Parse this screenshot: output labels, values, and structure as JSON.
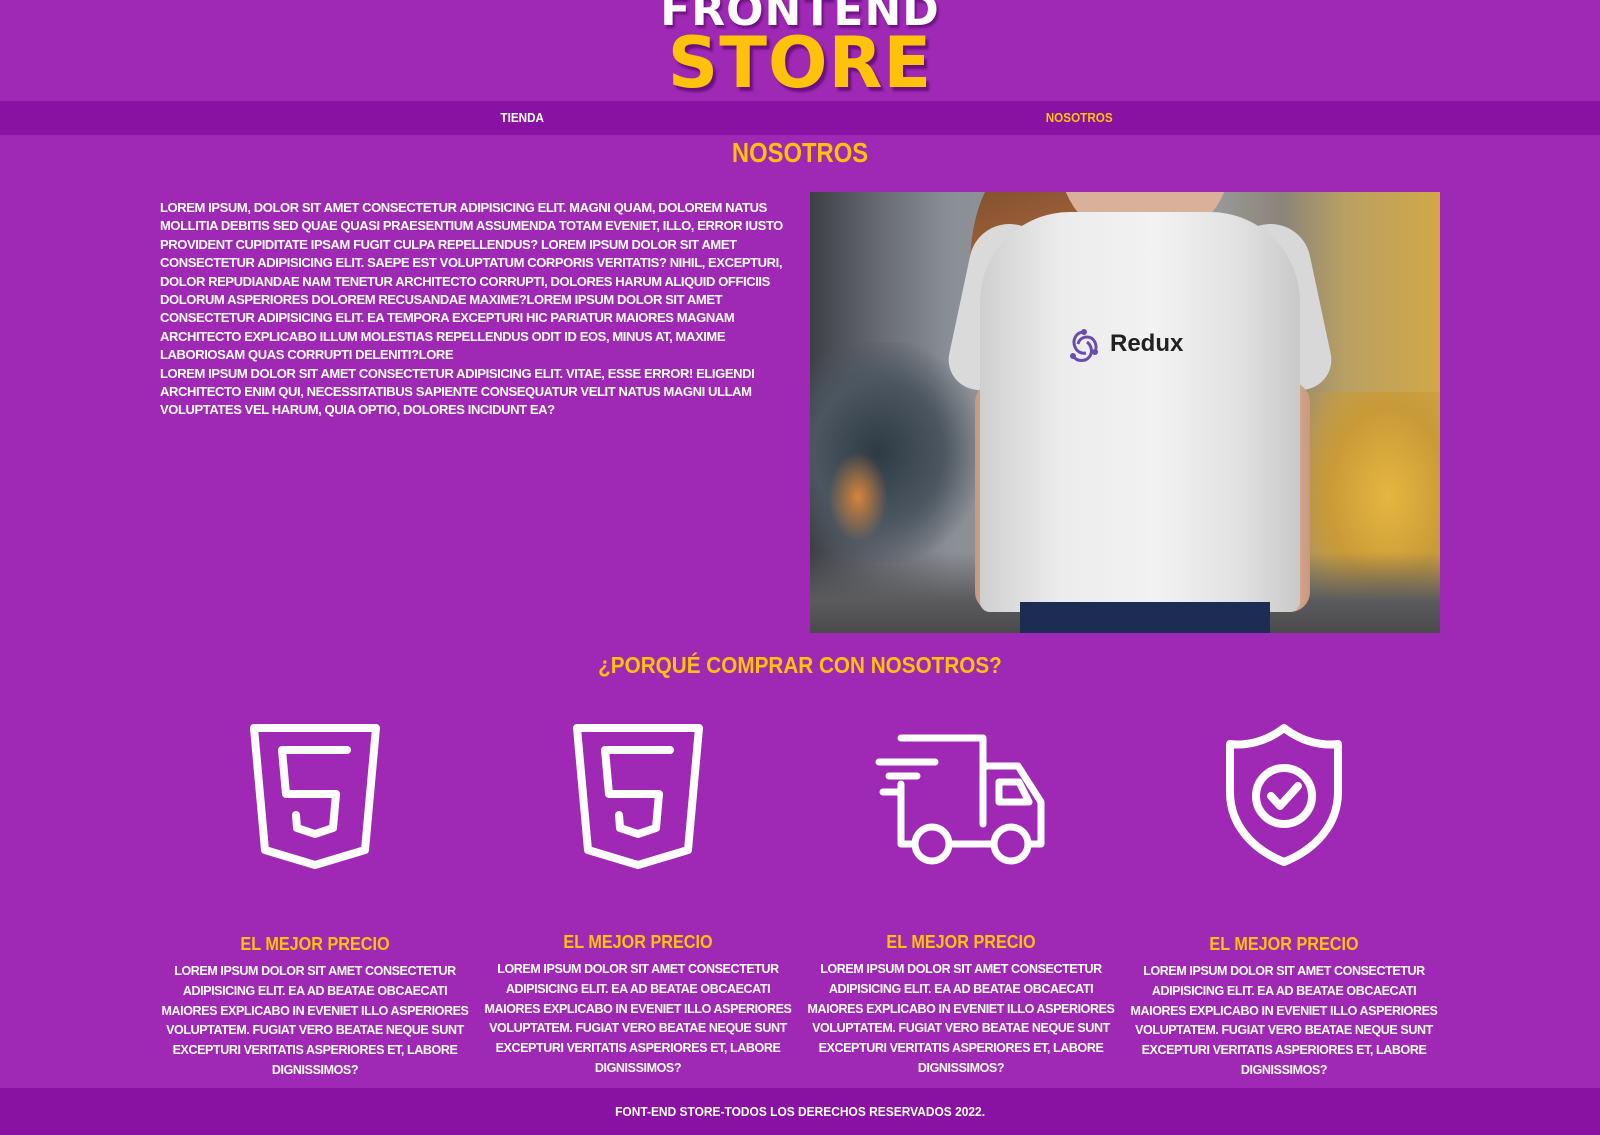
{
  "header": {
    "logo_top": "FRONTEND",
    "logo_bottom": "STORE"
  },
  "nav": {
    "items": [
      {
        "label": "TIENDA",
        "active": false
      },
      {
        "label": "NOSOTROS",
        "active": true
      }
    ]
  },
  "about": {
    "title": "NOSOTROS",
    "paragraphs": [
      "Lorem ipsum, dolor sit amet consectetur adipisicing elit. Magni quam, dolorem natus mollitia debitis sed quae quasi praesentium assumenda totam eveniet, illo, error iusto provident cupiditate ipsam fugit culpa repellendus? Lorem ipsum dolor sit amet consectetur adipisicing elit. Saepe est voluptatum corporis veritatis? Nihil, excepturi, dolor repudiandae nam tenetur architecto corrupti, dolores harum aliquid officiis dolorum asperiores dolorem recusandae maxime?Lorem ipsum dolor sit amet consectetur adipisicing elit. Ea tempora excepturi hic pariatur maiores magnam architecto explicabo illum molestias repellendus odit id eos, minus at, maxime laboriosam quas corrupti deleniti?lore",
      "Lorem ipsum dolor sit amet consectetur adipisicing elit. Vitae, esse error! Eligendi architecto enim qui, necessitatibus sapiente consequatur velit natus magni ullam voluptates vel harum, quia optio, dolores incidunt ea?"
    ],
    "image": {
      "icon": "redux-tshirt-photo",
      "shirt_print": "Redux"
    }
  },
  "why": {
    "title": "¿Porqué comprar con nosotros?",
    "features": [
      {
        "icon": "html5-shield-icon",
        "title": "El mejor precio",
        "text": "Lorem ipsum dolor sit amet consectetur adipisicing elit. Ea ad beatae obcaecati maiores explicabo in eveniet illo asperiores voluptatem. Fugiat vero beatae neque sunt excepturi veritatis asperiores et, labore dignissimos?"
      },
      {
        "icon": "html5-shield-icon",
        "title": "El mejor precio",
        "text": "Lorem ipsum dolor sit amet consectetur adipisicing elit. Ea ad beatae obcaecati maiores explicabo in eveniet illo asperiores voluptatem. Fugiat vero beatae neque sunt excepturi veritatis asperiores et, labore dignissimos?"
      },
      {
        "icon": "delivery-truck-icon",
        "title": "El mejor precio",
        "text": "Lorem ipsum dolor sit amet consectetur adipisicing elit. Ea ad beatae obcaecati maiores explicabo in eveniet illo asperiores voluptatem. Fugiat vero beatae neque sunt excepturi veritatis asperiores et, labore dignissimos?"
      },
      {
        "icon": "security-shield-check-icon",
        "title": "El mejor precio",
        "text": "Lorem ipsum dolor sit amet consectetur adipisicing elit. Ea ad beatae obcaecati maiores explicabo in eveniet illo asperiores voluptatem. Fugiat vero beatae neque sunt excepturi veritatis asperiores et, labore dignissimos?"
      }
    ]
  },
  "footer": {
    "text": "Font-end store-todos los derechos reservados 2022."
  },
  "colors": {
    "background": "#9f28b5",
    "nav_background": "#8a12a2",
    "accent": "#ffc20a",
    "text": "#ffffff"
  }
}
